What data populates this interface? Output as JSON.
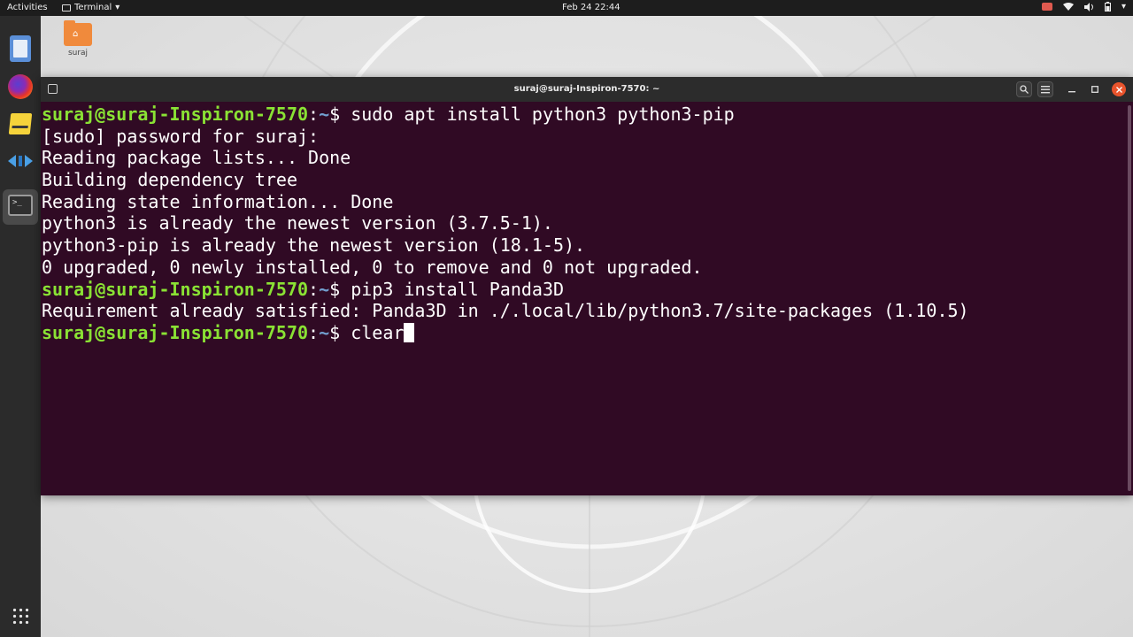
{
  "topbar": {
    "activities": "Activities",
    "app_name": "Terminal",
    "clock": "Feb 24  22:44"
  },
  "desktop": {
    "home_folder_label": "suraj"
  },
  "window": {
    "title": "suraj@suraj-Inspiron-7570: ~"
  },
  "terminal": {
    "lines": [
      {
        "kind": "prompt",
        "user": "suraj@suraj-Inspiron-7570",
        "path": "~",
        "command": "sudo apt install python3 python3-pip"
      },
      {
        "kind": "output",
        "text": "[sudo] password for suraj:"
      },
      {
        "kind": "output",
        "text": "Reading package lists... Done"
      },
      {
        "kind": "output",
        "text": "Building dependency tree"
      },
      {
        "kind": "output",
        "text": "Reading state information... Done"
      },
      {
        "kind": "output",
        "text": "python3 is already the newest version (3.7.5-1)."
      },
      {
        "kind": "output",
        "text": "python3-pip is already the newest version (18.1-5)."
      },
      {
        "kind": "output",
        "text": "0 upgraded, 0 newly installed, 0 to remove and 0 not upgraded."
      },
      {
        "kind": "prompt",
        "user": "suraj@suraj-Inspiron-7570",
        "path": "~",
        "command": "pip3 install Panda3D"
      },
      {
        "kind": "output",
        "text": "Requirement already satisfied: Panda3D in ./.local/lib/python3.7/site-packages (1.10.5)"
      },
      {
        "kind": "prompt",
        "user": "suraj@suraj-Inspiron-7570",
        "path": "~",
        "command": "clear",
        "cursor": true
      }
    ]
  },
  "colors": {
    "terminal_bg": "#300a24",
    "prompt_user": "#8ae234",
    "prompt_path": "#729fcf",
    "close_button": "#e9542c"
  }
}
